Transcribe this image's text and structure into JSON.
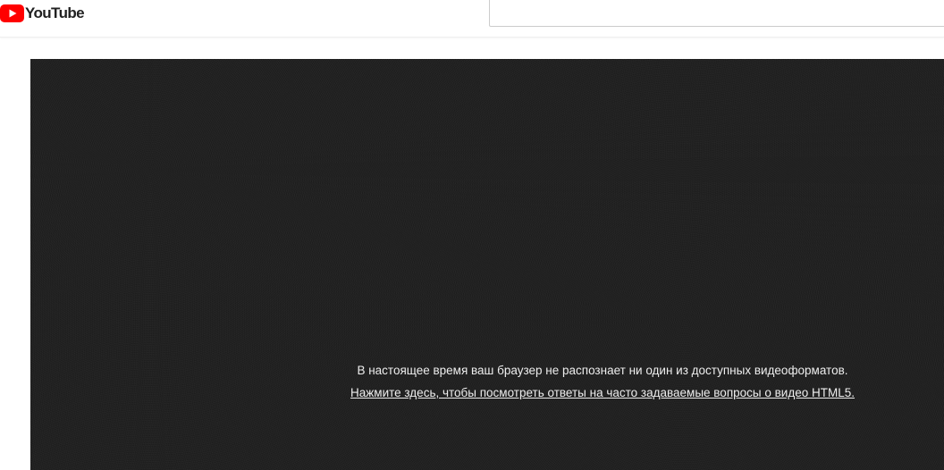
{
  "header": {
    "logo_text": "YouTube",
    "logo_icon": "youtube-play-icon",
    "brand_color": "#ff0000",
    "search": {
      "value": "",
      "placeholder": ""
    }
  },
  "player": {
    "background_color": "#1b1b1b",
    "error_message": "В настоящее время ваш браузер не распознает ни один из доступных видеоформатов.",
    "faq_link": "Нажмите здесь, чтобы посмотреть ответы на часто задаваемые вопросы о видео HTML5."
  }
}
